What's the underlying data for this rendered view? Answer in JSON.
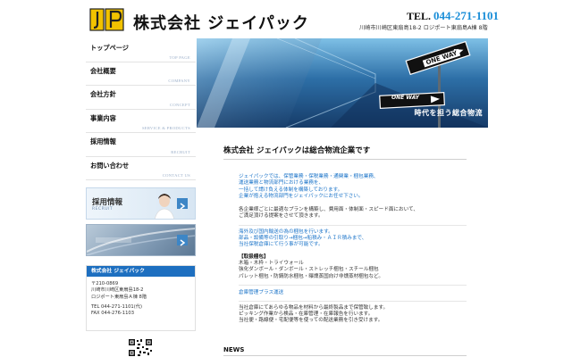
{
  "header": {
    "company_name": "株式会社 ジェイパック",
    "tel_label": "TEL.",
    "tel_number": "044-271-1101",
    "address": "川崎市川崎区東扇島18-2 ロジポート東扇島A棟 8階"
  },
  "nav": {
    "items": [
      {
        "ja": "トップページ",
        "en": "TOP PAGE"
      },
      {
        "ja": "会社概要",
        "en": "COMPANY"
      },
      {
        "ja": "会社方針",
        "en": "CONCEPT"
      },
      {
        "ja": "事業内容",
        "en": "SERVICE & PRODUCTS"
      },
      {
        "ja": "採用情報",
        "en": "RECRUIT"
      },
      {
        "ja": "お問い合わせ",
        "en": "CONTACT US"
      }
    ]
  },
  "banners": {
    "recruit_title": "採用情報",
    "recruit_sub": "RECRUIT"
  },
  "company": {
    "heading": "株式会社 ジェイパック",
    "zip": "〒210-0869",
    "addr1": "川崎市川崎区東扇島18-2",
    "addr2": "ロジポート東扇島Ａ棟 8階",
    "tel": "TEL 044-271-1101(代)",
    "fax": "FAX 044-276-1103"
  },
  "hero": {
    "caption": "時代を担う総合物流",
    "sign1": "ONE WAY",
    "sign2": "ONE WAY"
  },
  "main": {
    "title": "株式会社 ジェイパックは総合物流企業です",
    "intro_blue": [
      "ジェイパックでは、保管業務・保税業務・通関業・梱包業務、",
      "運送業務と物流部門における業務を、",
      "一括して請け負える体制を構築しております。",
      "企業が抱える物流部門をジェイパックにお任せ下さい。"
    ],
    "intro_black": [
      "各企業様ごとに最適なプランを構築し、費用面・体制面・スピード面において、",
      "ご満足頂ける提案をさせて頂きます。"
    ],
    "pack_blue": [
      "海外及び国内輸送の為の梱包を行います。",
      "部品・設備等の引取り→梱包→船積み・ＡＩＲ積みまで、",
      "当社保税倉庫にて行う事が可能です。"
    ],
    "pack_head": "【取扱梱包】",
    "pack_items": [
      "木箱・木枠・トライウォール",
      "強化ダンボール・ダンボール・ストレッチ梱包・スチール梱包",
      "パレット梱包・防錆防水梱包・曝燻蒸国向け非燻蒸材梱包など。"
    ],
    "warehouse_head": "倉庫管理プラス運送",
    "warehouse_lines": [
      "当社倉庫にてあらゆる物品を材料から最終製品まで保管致します。",
      "ピッキング作業から検品・在庫管理・在庫報告を行います。",
      "当社便・路線便・宅配便等を使っての配送業務を引き受けます。"
    ]
  },
  "news": {
    "title": "NEWS"
  },
  "colors": {
    "accent_blue": "#1a73c8",
    "header_blue": "#1d6fc0",
    "tel_blue": "#1a8ed8",
    "logo_yellow": "#f2c200"
  }
}
